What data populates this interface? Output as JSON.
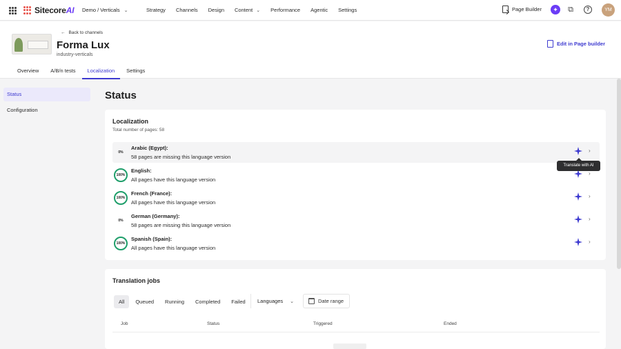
{
  "topbar": {
    "logo_text": "Sitecore",
    "logo_ai": "AI",
    "site_selector": "Demo / Verticals",
    "nav": [
      {
        "label": "Strategy",
        "dropdown": false
      },
      {
        "label": "Channels",
        "dropdown": false
      },
      {
        "label": "Design",
        "dropdown": false
      },
      {
        "label": "Content",
        "dropdown": true
      },
      {
        "label": "Performance",
        "dropdown": false
      },
      {
        "label": "Agentic",
        "dropdown": false
      },
      {
        "label": "Settings",
        "dropdown": false
      }
    ],
    "page_builder_label": "Page Builder",
    "avatar_initials": "YM"
  },
  "header": {
    "back_label": "Back to channels",
    "title": "Forma Lux",
    "subtitle": "industry-verticals",
    "edit_label": "Edit in Page builder",
    "tabs": [
      {
        "label": "Overview",
        "active": false
      },
      {
        "label": "A/B/n tests",
        "active": false
      },
      {
        "label": "Localization",
        "active": true
      },
      {
        "label": "Settings",
        "active": false
      }
    ]
  },
  "sidebar": {
    "items": [
      {
        "label": "Status",
        "active": true
      },
      {
        "label": "Configuration",
        "active": false
      }
    ]
  },
  "main": {
    "page_title": "Status",
    "localization": {
      "title": "Localization",
      "subtitle": "Total number of pages: 58",
      "rows": [
        {
          "percent": "0%",
          "name": "Arabic (Egypt):",
          "desc": "58 pages are missing this language version",
          "complete": false
        },
        {
          "percent": "100%",
          "name": "English:",
          "desc": "All pages have this language version",
          "complete": true
        },
        {
          "percent": "100%",
          "name": "French (France):",
          "desc": "All pages have this language version",
          "complete": true
        },
        {
          "percent": "0%",
          "name": "German (Germany):",
          "desc": "58 pages are missing this language version",
          "complete": false
        },
        {
          "percent": "100%",
          "name": "Spanish (Spain):",
          "desc": "All pages have this language version",
          "complete": true
        }
      ],
      "tooltip": "Translate with AI"
    },
    "translation_jobs": {
      "title": "Translation jobs",
      "filters": [
        {
          "label": "All",
          "active": true
        },
        {
          "label": "Queued",
          "active": false
        },
        {
          "label": "Running",
          "active": false
        },
        {
          "label": "Completed",
          "active": false
        },
        {
          "label": "Failed",
          "active": false
        }
      ],
      "languages_label": "Languages",
      "date_range_label": "Date range",
      "columns": [
        "Job",
        "Status",
        "Triggered",
        "Ended"
      ]
    }
  },
  "colors": {
    "accent": "#3d3ad0",
    "ai_purple": "#6b3cf6",
    "complete_green": "#1e9e6a"
  }
}
